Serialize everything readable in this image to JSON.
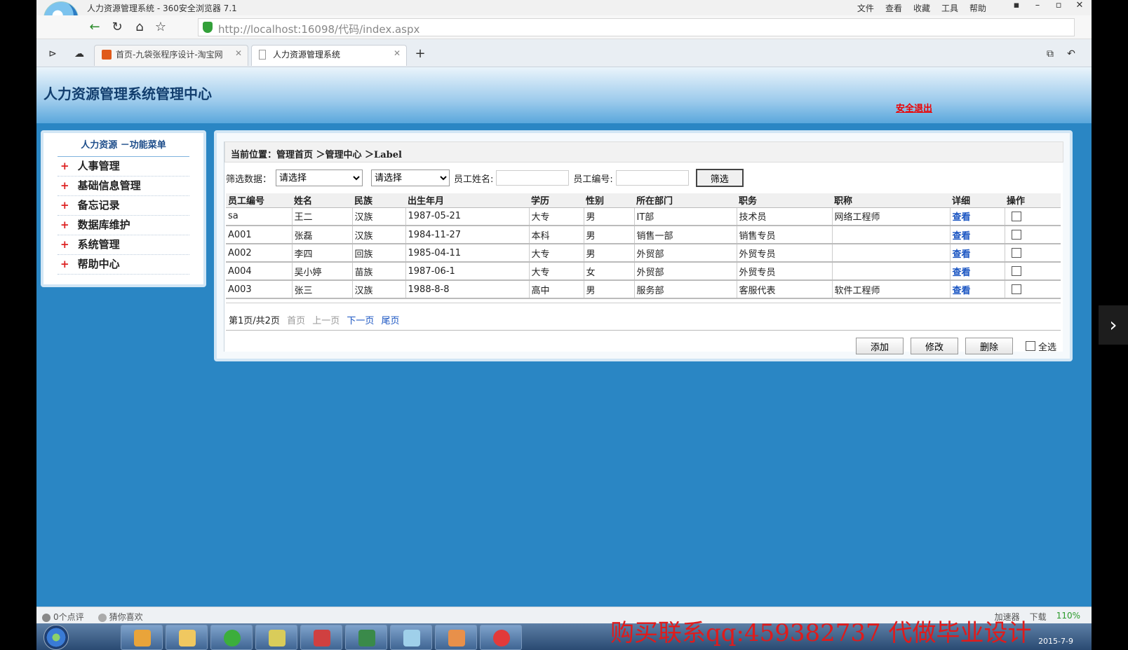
{
  "browser": {
    "window_title": "人力资源管理系统 - 360安全浏览器 7.1",
    "menu": [
      "文件",
      "查看",
      "收藏",
      "工具",
      "帮助"
    ],
    "url": "http://localhost:16098/代码/index.aspx",
    "tabs": [
      {
        "label": "首页-九袋张程序设计-淘宝网",
        "active": false
      },
      {
        "label": "人力资源管理系统",
        "active": true
      }
    ]
  },
  "header": {
    "title": "人力资源管理系统管理中心",
    "logout": "安全退出"
  },
  "sidebar": {
    "title": "人力资源 －功能菜单",
    "items": [
      {
        "label": "人事管理"
      },
      {
        "label": "基础信息管理"
      },
      {
        "label": "备忘记录"
      },
      {
        "label": "数据库维护"
      },
      {
        "label": "系统管理"
      },
      {
        "label": "帮助中心"
      }
    ]
  },
  "main": {
    "breadcrumb": "当前位置：管理首页 ＞管理中心 ＞Label",
    "filter": {
      "label": "筛选数据：",
      "select1": "请选择",
      "select2": "请选择",
      "name_label": "员工姓名:",
      "id_label": "员工编号:",
      "button": "筛选"
    },
    "table": {
      "headers": [
        "员工编号",
        "姓名",
        "民族",
        "出生年月",
        "学历",
        "性别",
        "所在部门",
        "职务",
        "职称",
        "详细",
        "操作"
      ],
      "rows": [
        [
          "sa",
          "王二",
          "汉族",
          "1987-05-21",
          "大专",
          "男",
          "IT部",
          "技术员",
          "网络工程师",
          "查看"
        ],
        [
          "A001",
          "张磊",
          "汉族",
          "1984-11-27",
          "本科",
          "男",
          "销售一部",
          "销售专员",
          "",
          "查看"
        ],
        [
          "A002",
          "李四",
          "回族",
          "1985-04-11",
          "大专",
          "男",
          "外贸部",
          "外贸专员",
          "",
          "查看"
        ],
        [
          "A004",
          "吴小婷",
          "苗族",
          "1987-06-1",
          "大专",
          "女",
          "外贸部",
          "外贸专员",
          "",
          "查看"
        ],
        [
          "A003",
          "张三",
          "汉族",
          "1988-8-8",
          "高中",
          "男",
          "服务部",
          "客服代表",
          "软件工程师",
          "查看"
        ]
      ]
    },
    "pager": {
      "info": "第1页/共2页",
      "first": "首页",
      "prev": "上一页",
      "next": "下一页",
      "last": "尾页"
    },
    "actions": {
      "add": "添加",
      "edit": "修改",
      "delete": "删除",
      "select_all": "全选"
    }
  },
  "statusbar": {
    "left": [
      "0个点评",
      "猜你喜欢"
    ],
    "right": [
      "加速器",
      "下载",
      "110%"
    ]
  },
  "taskbar": {
    "clock_date": "2015-7-9"
  },
  "watermark": "购买联系qq:459382737 代做毕业设计"
}
